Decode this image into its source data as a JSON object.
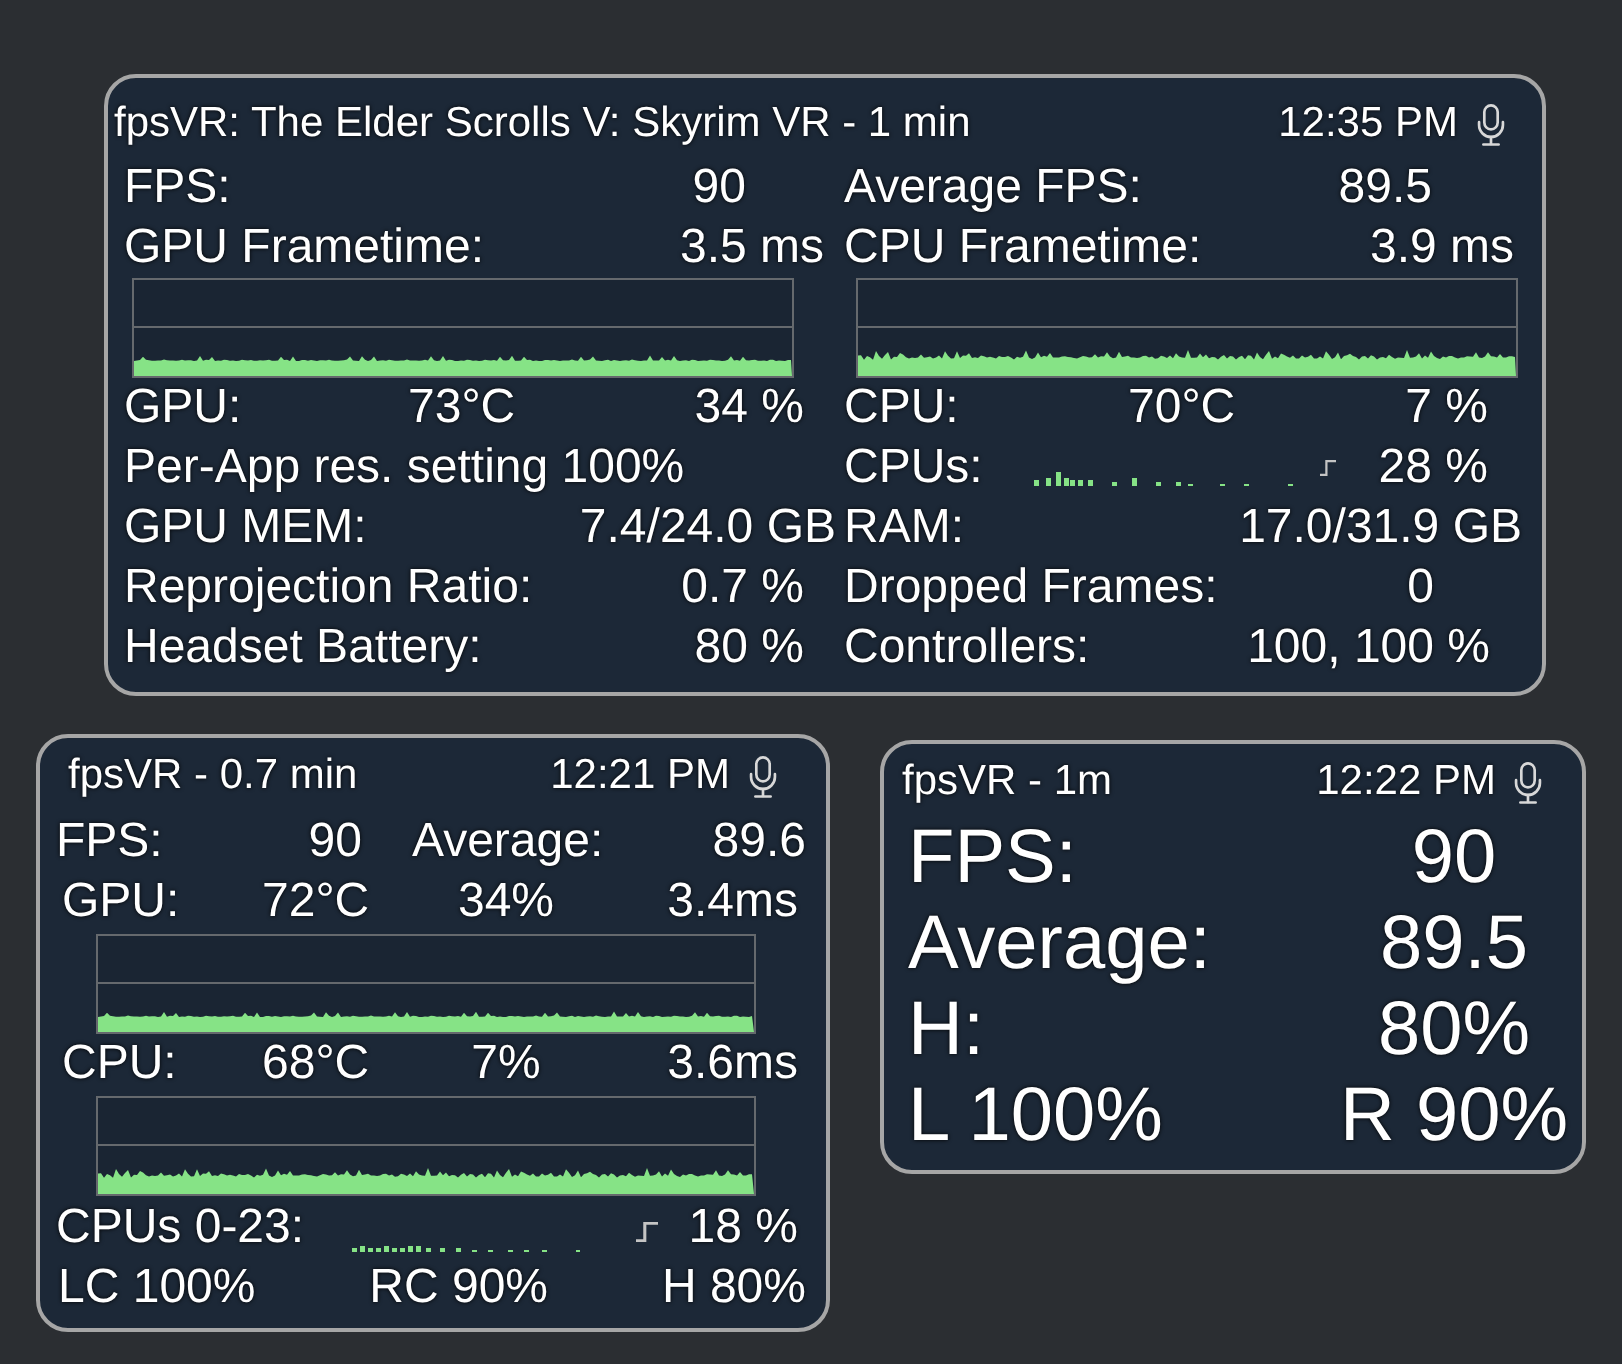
{
  "full_overlay": {
    "title": "fpsVR: The Elder Scrolls V: Skyrim VR - 1 min",
    "time": "12:35 PM",
    "cells": [
      {
        "kind": "stat",
        "label": "FPS:",
        "value": "90"
      },
      {
        "kind": "stat",
        "label": "Average FPS:",
        "value": "89.5"
      },
      {
        "kind": "stat",
        "label": "GPU Frametime:",
        "value": "3.5 ms"
      },
      {
        "kind": "stat",
        "label": "CPU Frametime:",
        "value": "3.9 ms"
      },
      {
        "kind": "graph"
      },
      {
        "kind": "graph"
      },
      {
        "kind": "sensor",
        "label": "GPU:",
        "temperature": "73°C",
        "load": "34 %"
      },
      {
        "kind": "sensor",
        "label": "CPU:",
        "temperature": "70°C",
        "load": "7 %"
      },
      {
        "kind": "note",
        "text": "Per-App res. setting 100%"
      },
      {
        "kind": "cores",
        "label": "CPUs:",
        "value": "28 %"
      },
      {
        "kind": "stat",
        "label": "GPU MEM:",
        "value": "7.4/24.0 GB"
      },
      {
        "kind": "stat",
        "label": "RAM:",
        "value": "17.0/31.9 GB"
      },
      {
        "kind": "stat",
        "label": "Reprojection Ratio:",
        "value": "0.7 %"
      },
      {
        "kind": "stat",
        "label": "Dropped Frames:",
        "value": "0"
      },
      {
        "kind": "stat",
        "label": "Headset Battery:",
        "value": "80 %"
      },
      {
        "kind": "stat",
        "label": "Controllers:",
        "value": "100, 100 %"
      }
    ]
  },
  "compact_overlay": {
    "title": "fpsVR - 0.7 min",
    "time": "12:21 PM",
    "rows": [
      {
        "kind": "pairs",
        "cells": [
          "FPS:",
          "90",
          "Average:",
          "89.6"
        ]
      },
      {
        "kind": "readings",
        "cells": [
          "GPU:",
          "72°C",
          "34%",
          "3.4ms"
        ]
      },
      {
        "kind": "graph"
      },
      {
        "kind": "readings",
        "cells": [
          "CPU:",
          "68°C",
          "7%",
          "3.6ms"
        ]
      },
      {
        "kind": "graph"
      },
      {
        "kind": "cores",
        "label": "CPUs 0-23:",
        "value": "18 %"
      },
      {
        "kind": "spread",
        "cells": [
          "LC 100%",
          "RC 90%",
          "H 80%"
        ]
      }
    ]
  },
  "minimal_overlay": {
    "title": "fpsVR - 1m",
    "time": "12:22 PM",
    "rows": [
      {
        "label": "FPS:",
        "value": "90"
      },
      {
        "label": "Average:",
        "value": "89.5"
      },
      {
        "label": "H:",
        "value": "80%"
      },
      {
        "label": "L 100%",
        "value": "R 90%"
      }
    ]
  }
}
